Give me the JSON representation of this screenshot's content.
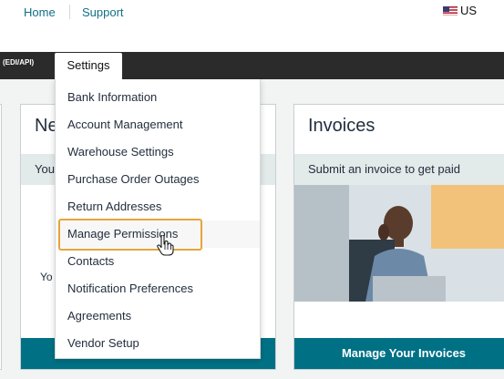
{
  "header": {
    "links": [
      "Home",
      "Support"
    ],
    "locale": "US"
  },
  "navbar": {
    "left_fragment": "(EDI/API)",
    "active_tab": "Settings"
  },
  "settings_menu": {
    "items": [
      "Bank Information",
      "Account Management",
      "Warehouse Settings",
      "Purchase Order Outages",
      "Return Addresses",
      "Manage Permissions",
      "Contacts",
      "Notification Preferences",
      "Agreements",
      "Vendor Setup"
    ],
    "highlighted": "Manage Permissions"
  },
  "cards": {
    "new_card": {
      "title_fragment": "Ne",
      "subtitle_fragment": "You",
      "body_fragment": "Yo"
    },
    "invoices": {
      "title": "Invoices",
      "subtitle": "Submit an invoice to get paid",
      "button": "Manage Your Invoices"
    }
  },
  "colors": {
    "link": "#0f6f84",
    "navbar": "#2b2b2b",
    "button": "#007185",
    "highlight": "#e8a33a",
    "card_subbar": "#e3eaea"
  },
  "icons": [
    "us-flag-icon",
    "hand-cursor-icon"
  ]
}
